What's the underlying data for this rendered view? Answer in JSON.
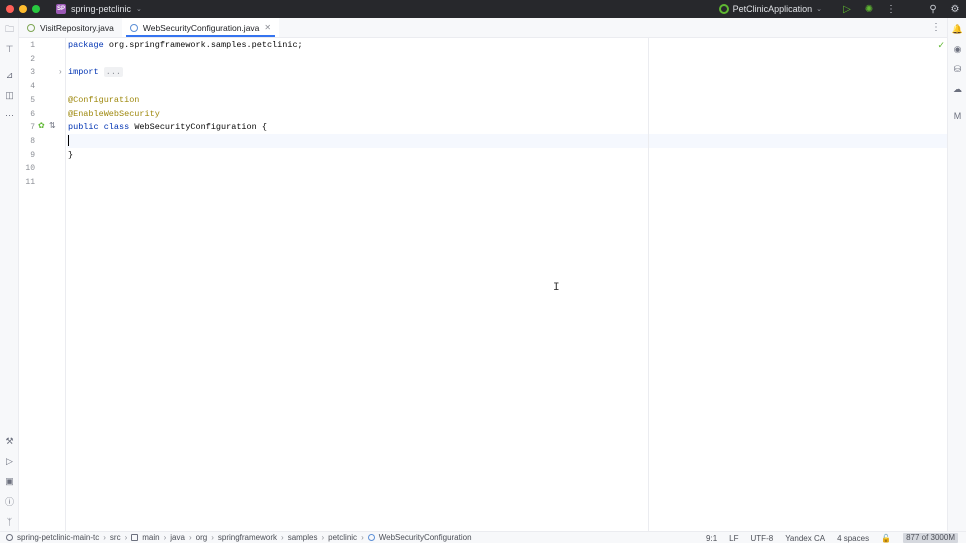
{
  "titlebar": {
    "project_badge": "SP",
    "project_name": "spring-petclinic",
    "run_config": "PetClinicApplication"
  },
  "tabs": [
    {
      "label": "VisitRepository.java",
      "active": false
    },
    {
      "label": "WebSecurityConfiguration.java",
      "active": true
    }
  ],
  "editor": {
    "line_numbers": [
      "1",
      "2",
      "3",
      "4",
      "5",
      "6",
      "7",
      "8",
      "9",
      "10",
      "11"
    ],
    "code": {
      "line1_kw": "package",
      "line1_rest": " org.springframework.samples.petclinic;",
      "line3_kw": "import",
      "line3_folded": "...",
      "line6_ann": "@Configuration",
      "line7_ann": "@EnableWebSecurity",
      "line8_kw": "public class",
      "line8_rest": " WebSecurityConfiguration {",
      "line10": "}"
    }
  },
  "statusbar": {
    "breadcrumbs": [
      "spring-petclinic-main-tc",
      "src",
      "main",
      "java",
      "org",
      "springframework",
      "samples",
      "petclinic",
      "WebSecurityConfiguration"
    ],
    "position": "9:1",
    "line_separator": "LF",
    "encoding": "UTF-8",
    "cert": "Yandex CA",
    "indent": "4 spaces",
    "memory": "877 of 3000M"
  },
  "colors": {
    "accent": "#3574f0",
    "keyword": "#0033b3",
    "annotation": "#9e880d",
    "success": "#5fb832"
  }
}
